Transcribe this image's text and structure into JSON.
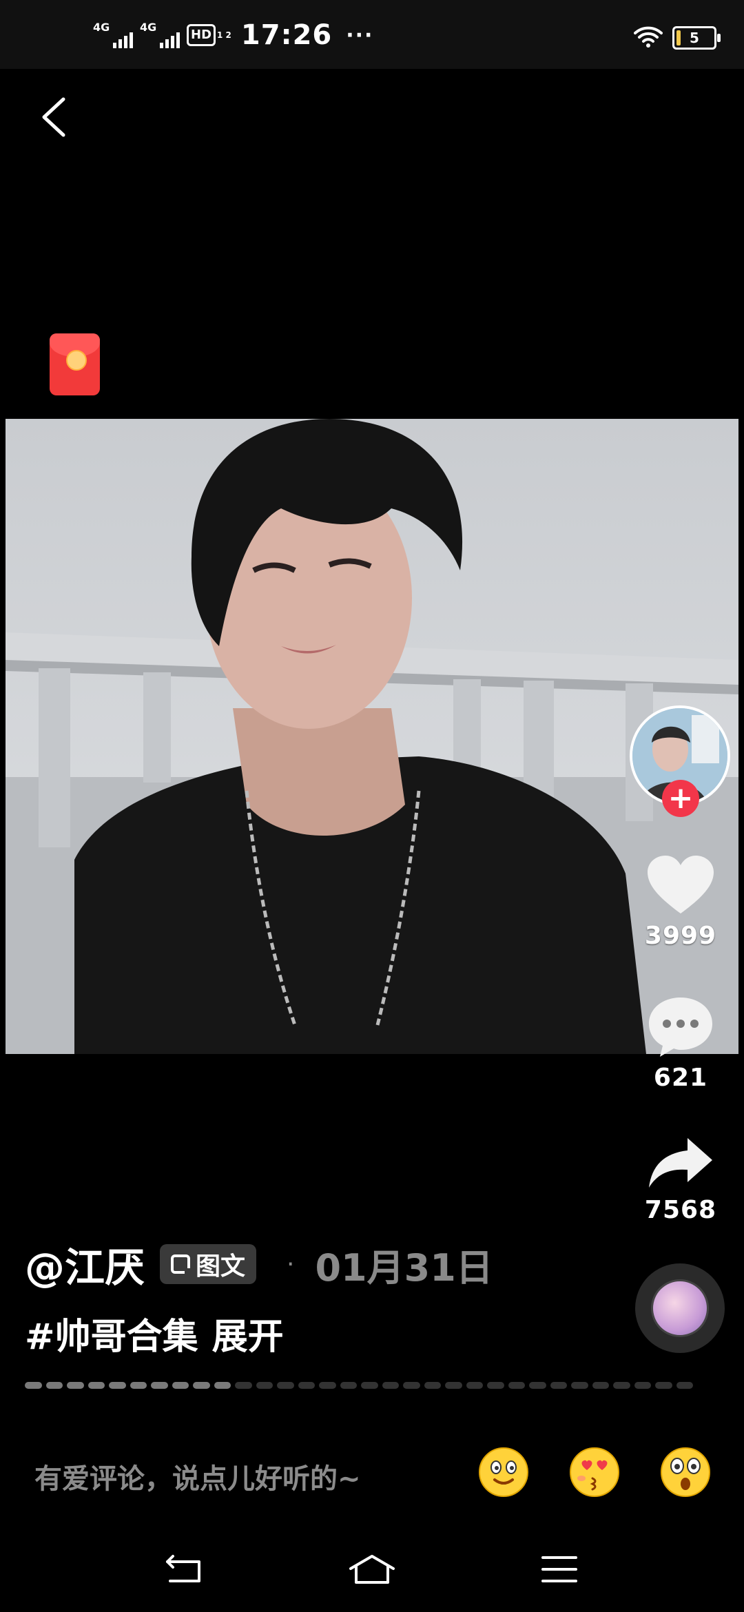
{
  "status_bar": {
    "network1": "4G",
    "network2": "4G",
    "hd_label": "HD",
    "hd_fraction": "1 2",
    "time": "17:26",
    "more": "···",
    "battery_level": "5"
  },
  "post": {
    "author": "@江厌",
    "type_label": "图文",
    "separator": "·",
    "date": "01月31日",
    "hashtag": "#帅哥合集",
    "expand_label": "展开",
    "image_count": 32,
    "current_image": 10
  },
  "actions": {
    "like_count": "3999",
    "comment_count": "621",
    "share_count": "7568"
  },
  "comment_bar": {
    "placeholder": "有爱评论，说点儿好听的~"
  },
  "colors": {
    "accent_red": "#f2364a",
    "red_packet": "#f23a3a",
    "muted_text": "#8a8a8a"
  }
}
